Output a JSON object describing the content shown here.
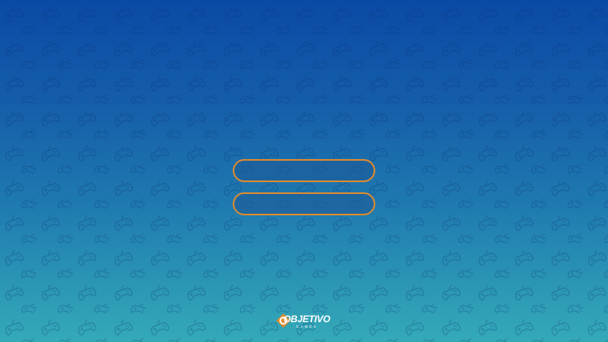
{
  "menu": {
    "buttons": [
      {
        "label": ""
      },
      {
        "label": ""
      }
    ]
  },
  "logo": {
    "word": "OBJETIVO",
    "sub": "GAMES",
    "mark_icon": "diamond-o-icon"
  },
  "background": {
    "pattern_icon": "gamepad-icon",
    "top_color": "#0a4aa6",
    "bottom_color": "#34aab8"
  },
  "colors": {
    "accent": "#e08a2c"
  }
}
